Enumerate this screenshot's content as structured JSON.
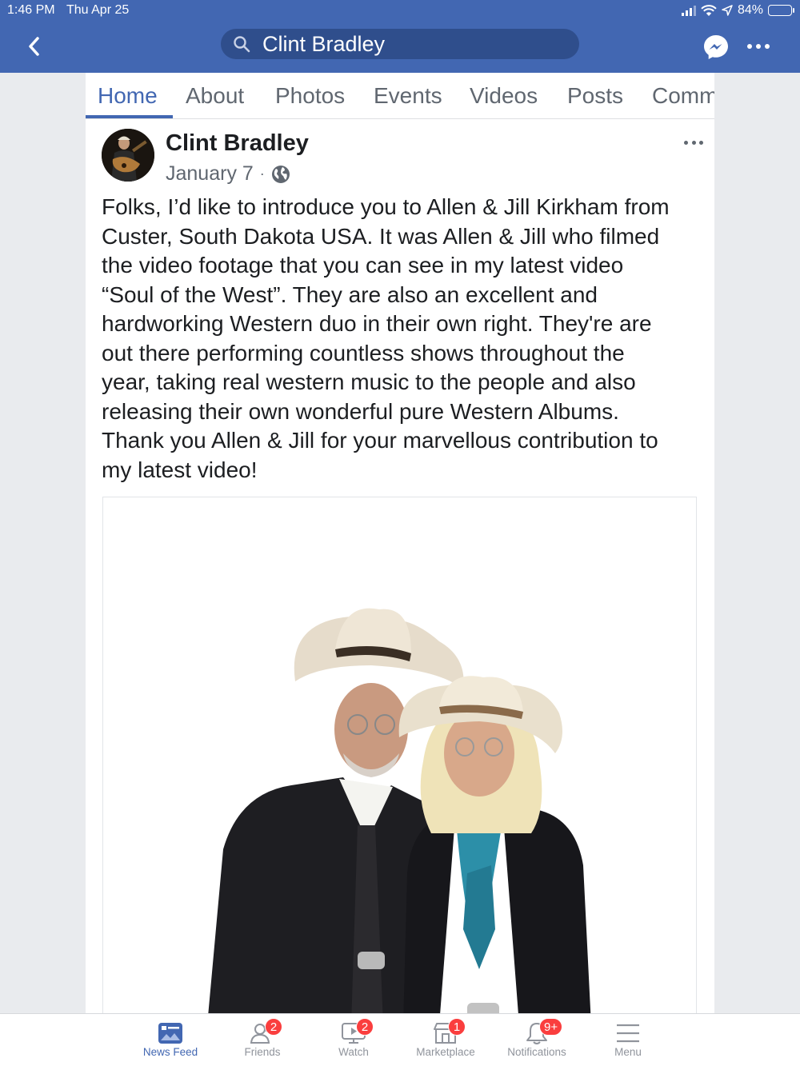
{
  "status_bar": {
    "time": "1:46 PM",
    "date": "Thu Apr 25",
    "battery": "84%",
    "battery_level": 0.84
  },
  "search": {
    "value": "Clint Bradley"
  },
  "tabs": [
    {
      "label": "Home"
    },
    {
      "label": "About"
    },
    {
      "label": "Photos"
    },
    {
      "label": "Events"
    },
    {
      "label": "Videos"
    },
    {
      "label": "Posts"
    },
    {
      "label": "Comm"
    }
  ],
  "post": {
    "author": "Clint Bradley",
    "date": "January 7",
    "separator": "·",
    "lines": [
      "Folks, I’d like to introduce you to Allen & Jill Kirkham from",
      "Custer, South Dakota USA. It was Allen & Jill who filmed",
      "the video footage that you can see in my latest video",
      "“Soul of the West”. They are also an excellent and",
      "hardworking Western duo in their own right. They're are",
      "out there performing countless shows throughout the",
      "year, taking real western music to the people and also",
      "releasing their own wonderful pure Western Albums.",
      "Thank you Allen & Jill for your marvellous contribution to",
      "my latest video!"
    ]
  },
  "bottom_nav": [
    {
      "label": "News Feed",
      "icon": "news-feed-icon",
      "badge": ""
    },
    {
      "label": "Friends",
      "icon": "friends-icon",
      "badge": "2"
    },
    {
      "label": "Watch",
      "icon": "watch-icon",
      "badge": "2"
    },
    {
      "label": "Marketplace",
      "icon": "marketplace-icon",
      "badge": "1"
    },
    {
      "label": "Notifications",
      "icon": "notifications-icon",
      "badge": "9+"
    },
    {
      "label": "Menu",
      "icon": "menu-icon",
      "badge": ""
    }
  ],
  "colors": {
    "brand": "#4267b2",
    "badge": "#fa3e3e",
    "text": "#1c1e21",
    "muted": "#606770"
  }
}
